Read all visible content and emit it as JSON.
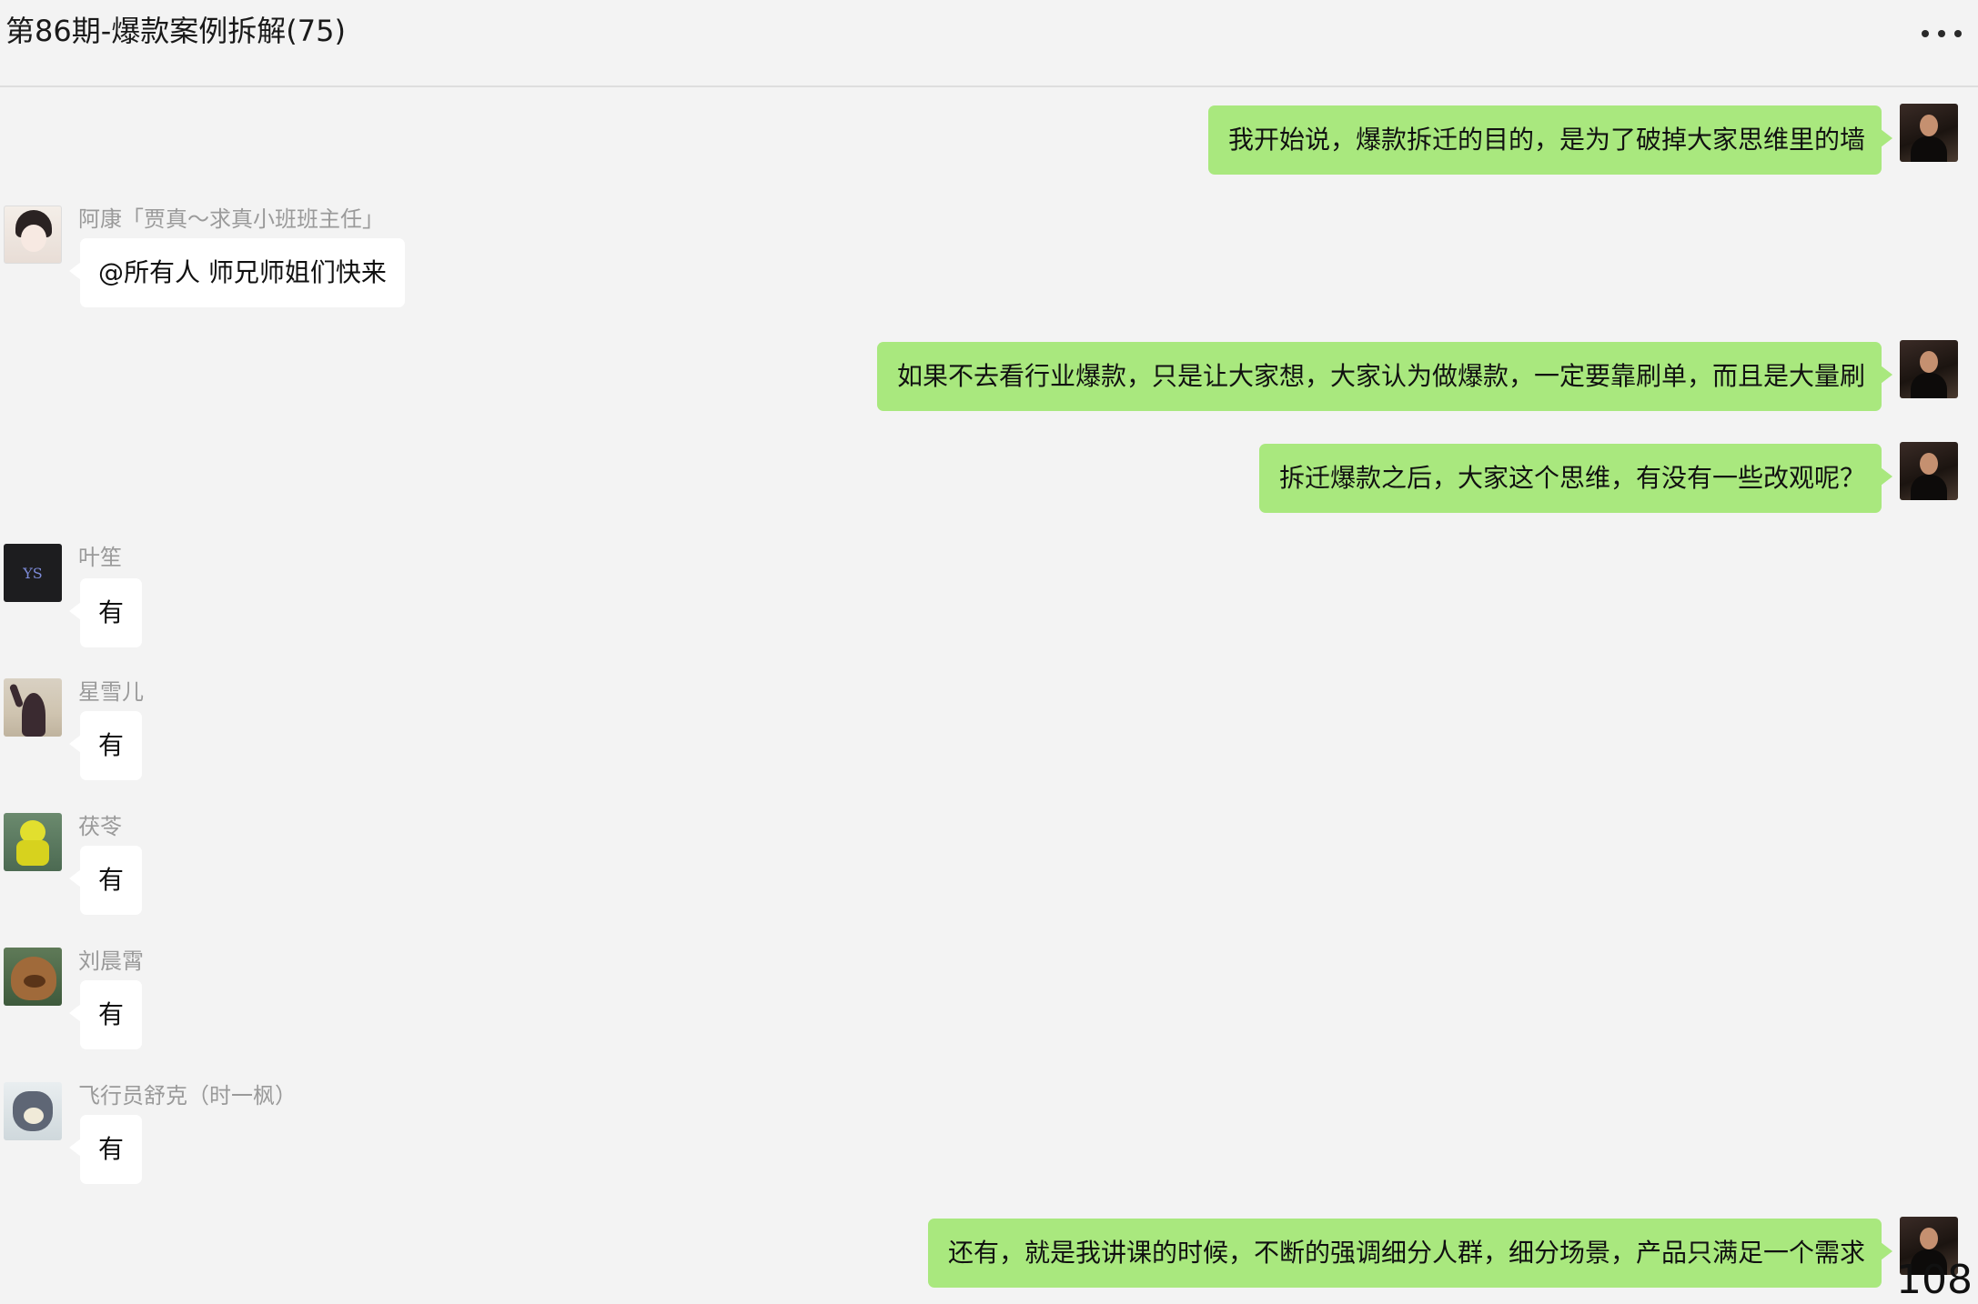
{
  "header": {
    "title": "第86期-爆款案例拆解(75)"
  },
  "messages": [
    {
      "from": "me",
      "text": "我开始说，爆款拆迁的目的，是为了破掉大家思维里的墙"
    },
    {
      "from": "other",
      "sender": "阿康「贾真～求真小班班主任」",
      "text": "@所有人 师兄师姐们快来"
    },
    {
      "from": "me",
      "text": "如果不去看行业爆款，只是让大家想，大家认为做爆款，一定要靠刷单，而且是大量刷"
    },
    {
      "from": "me",
      "text": "拆迁爆款之后，大家这个思维，有没有一些改观呢？"
    },
    {
      "from": "other",
      "sender": "叶笙",
      "avatar_text": "YS",
      "text": "有"
    },
    {
      "from": "other",
      "sender": "星雪儿",
      "text": "有"
    },
    {
      "from": "other",
      "sender": "茯苓",
      "text": "有"
    },
    {
      "from": "other",
      "sender": "刘晨霄",
      "text": "有"
    },
    {
      "from": "other",
      "sender": "飞行员舒克（时一枫）",
      "text": "有"
    },
    {
      "from": "me",
      "text": "还有，就是我讲课的时候，不断的强调细分人群，细分场景，产品只满足一个需求"
    }
  ],
  "page_indicator": "108"
}
